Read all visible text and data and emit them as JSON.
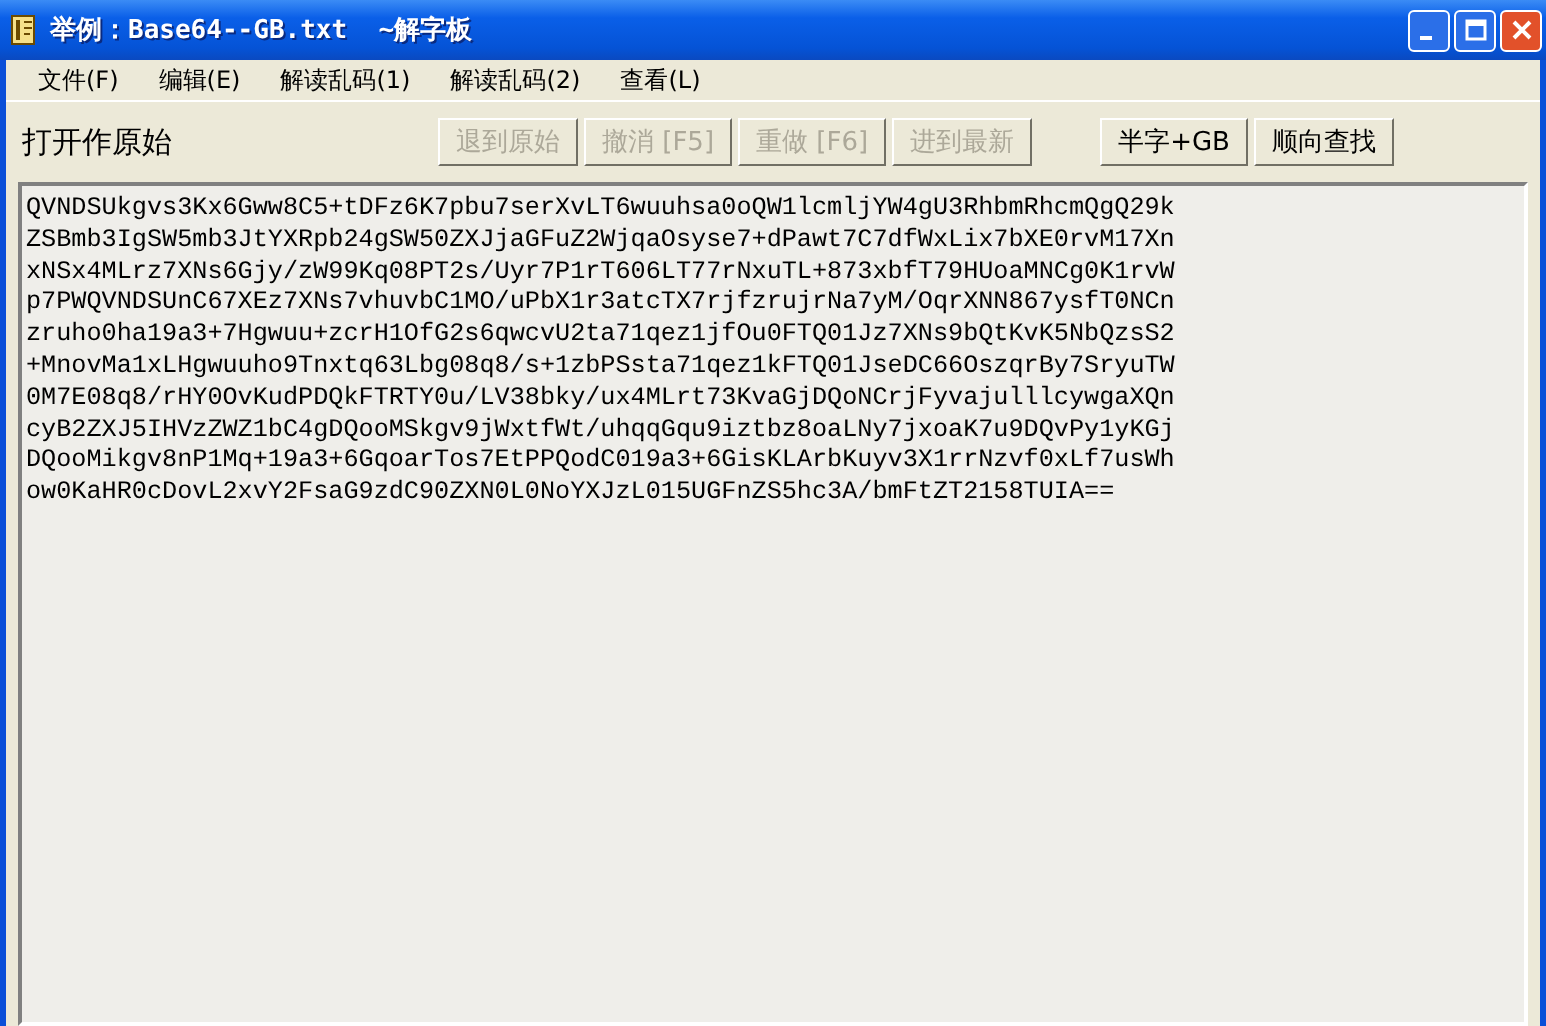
{
  "window": {
    "title": "举例：Base64--GB.txt  ~解字板"
  },
  "menu": [
    {
      "label": "文件(F)"
    },
    {
      "label": "编辑(E)"
    },
    {
      "label": "解读乱码(1)"
    },
    {
      "label": "解读乱码(2)"
    },
    {
      "label": "查看(L)"
    }
  ],
  "toolbar": {
    "label": "打开作原始",
    "buttons": [
      {
        "label": "退到原始",
        "disabled": true
      },
      {
        "label": "撤消 [F5]",
        "disabled": true
      },
      {
        "label": "重做 [F6]",
        "disabled": true
      },
      {
        "label": "进到最新",
        "disabled": true
      }
    ],
    "right_buttons": [
      {
        "label": "半字+GB",
        "disabled": false
      },
      {
        "label": "顺向查找",
        "disabled": false
      }
    ]
  },
  "editor": {
    "lines": [
      "QVNDSUkgvs3Kx6Gww8C5+tDFz6K7pbu7serXvLT6wuuhsa0oQW1lcmljYW4gU3RhbmRhcmQgQ29k",
      "ZSBmb3IgSW5mb3JtYXRpb24gSW50ZXJjaGFuZ2WjqaOsyse7+dPawt7C7dfWxLix7bXE0rvM17Xn",
      "xNSx4MLrz7XNs6Gjy/zW99Kq08PT2s/Uyr7P1rT606LT77rNxuTL+873xbfT79HUoaMNCg0K1rvW",
      "p7PWQVNDSUnC67XEz7XNs7vhuvbC1MO/uPbX1r3atcTX7rjfzrujrNa7yM/OqrXNN867ysfT0NCn",
      "zruho0ha19a3+7Hgwuu+zcrH1OfG2s6qwcvU2ta71qez1jfOu0FTQ01Jz7XNs9bQtKvK5NbQzsS2",
      "+MnovMa1xLHgwuuho9Tnxtq63Lbg08q8/s+1zbPSsta71qez1kFTQ01JseDC66OszqrBy7SryuTW",
      "0M7E08q8/rHY0OvKudPDQkFTRTY0u/LV38bky/ux4MLrt73KvaGjDQoNCrjFyvajulllcywgaXQn",
      "cyB2ZXJ5IHVzZWZ1bC4gDQooMSkgv9jWxtfWt/uhqqGqu9iztbz8oaLNy7jxoaK7u9DQvPy1yKGj",
      "DQooMikgv8nP1Mq+19a3+6GqoarTos7EtPPQodC019a3+6GisKLArbKuyv3X1rrNzvf0xLf7usWh",
      "ow0KaHR0cDovL2xvY2FsaG9zdC90ZXN0L0NoYXJzL015UGFnZS5hc3A/bmFtZT2158TUIA=="
    ]
  }
}
